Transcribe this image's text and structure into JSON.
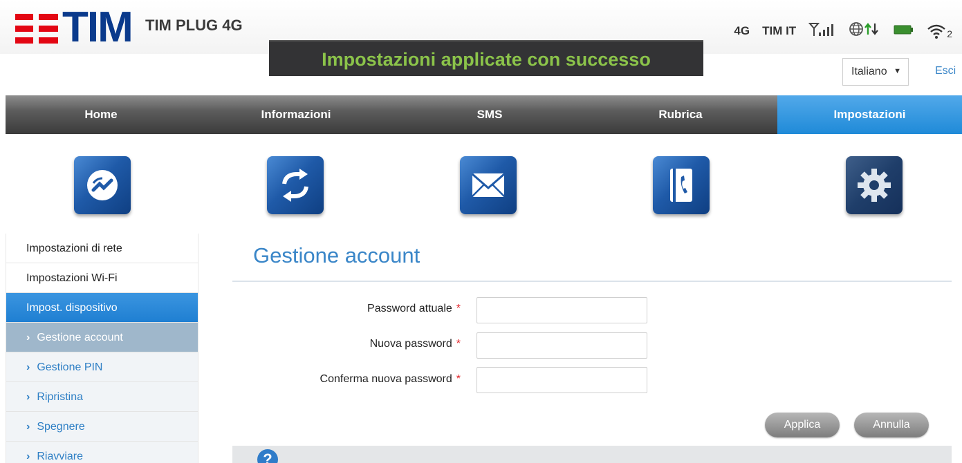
{
  "header": {
    "brand": "TIM",
    "product": "TIM PLUG 4G",
    "network_type": "4G",
    "operator": "TIM IT",
    "wifi_clients": "2",
    "icons": [
      "signal-icon",
      "globe-icon",
      "data-transfer-icon",
      "battery-icon",
      "wifi-icon"
    ]
  },
  "toast": {
    "message": "Impostazioni applicate con successo"
  },
  "language": {
    "selected": "Italiano",
    "logout_label": "Esci"
  },
  "nav": {
    "items": [
      {
        "label": "Home"
      },
      {
        "label": "Informazioni"
      },
      {
        "label": "SMS"
      },
      {
        "label": "Rubrica"
      },
      {
        "label": "Impostazioni"
      }
    ],
    "active": "Impostazioni"
  },
  "icons_row": [
    "home-connection-icon",
    "info-refresh-icon",
    "sms-envelope-icon",
    "phonebook-icon",
    "settings-gear-icon"
  ],
  "sidebar": {
    "items": [
      {
        "label": "Impostazioni di rete"
      },
      {
        "label": "Impostazioni Wi-Fi"
      },
      {
        "label": "Impost. dispositivo"
      }
    ],
    "sub_items": [
      {
        "label": "Gestione account"
      },
      {
        "label": "Gestione PIN"
      },
      {
        "label": "Ripristina"
      },
      {
        "label": "Spegnere"
      },
      {
        "label": "Riavviare"
      }
    ],
    "sub_arrow": "›"
  },
  "main": {
    "title": "Gestione account",
    "fields": [
      {
        "label": "Password attuale",
        "value": ""
      },
      {
        "label": "Nuova password",
        "value": ""
      },
      {
        "label": "Conferma nuova password",
        "value": ""
      }
    ],
    "required_mark": "*",
    "apply_label": "Applica",
    "cancel_label": "Annulla",
    "help_symbol": "?"
  },
  "colors": {
    "accent": "#1f8ad8",
    "brand_blue": "#0a3a8c",
    "brand_red": "#e30613",
    "toast_text": "#8bc34a"
  }
}
